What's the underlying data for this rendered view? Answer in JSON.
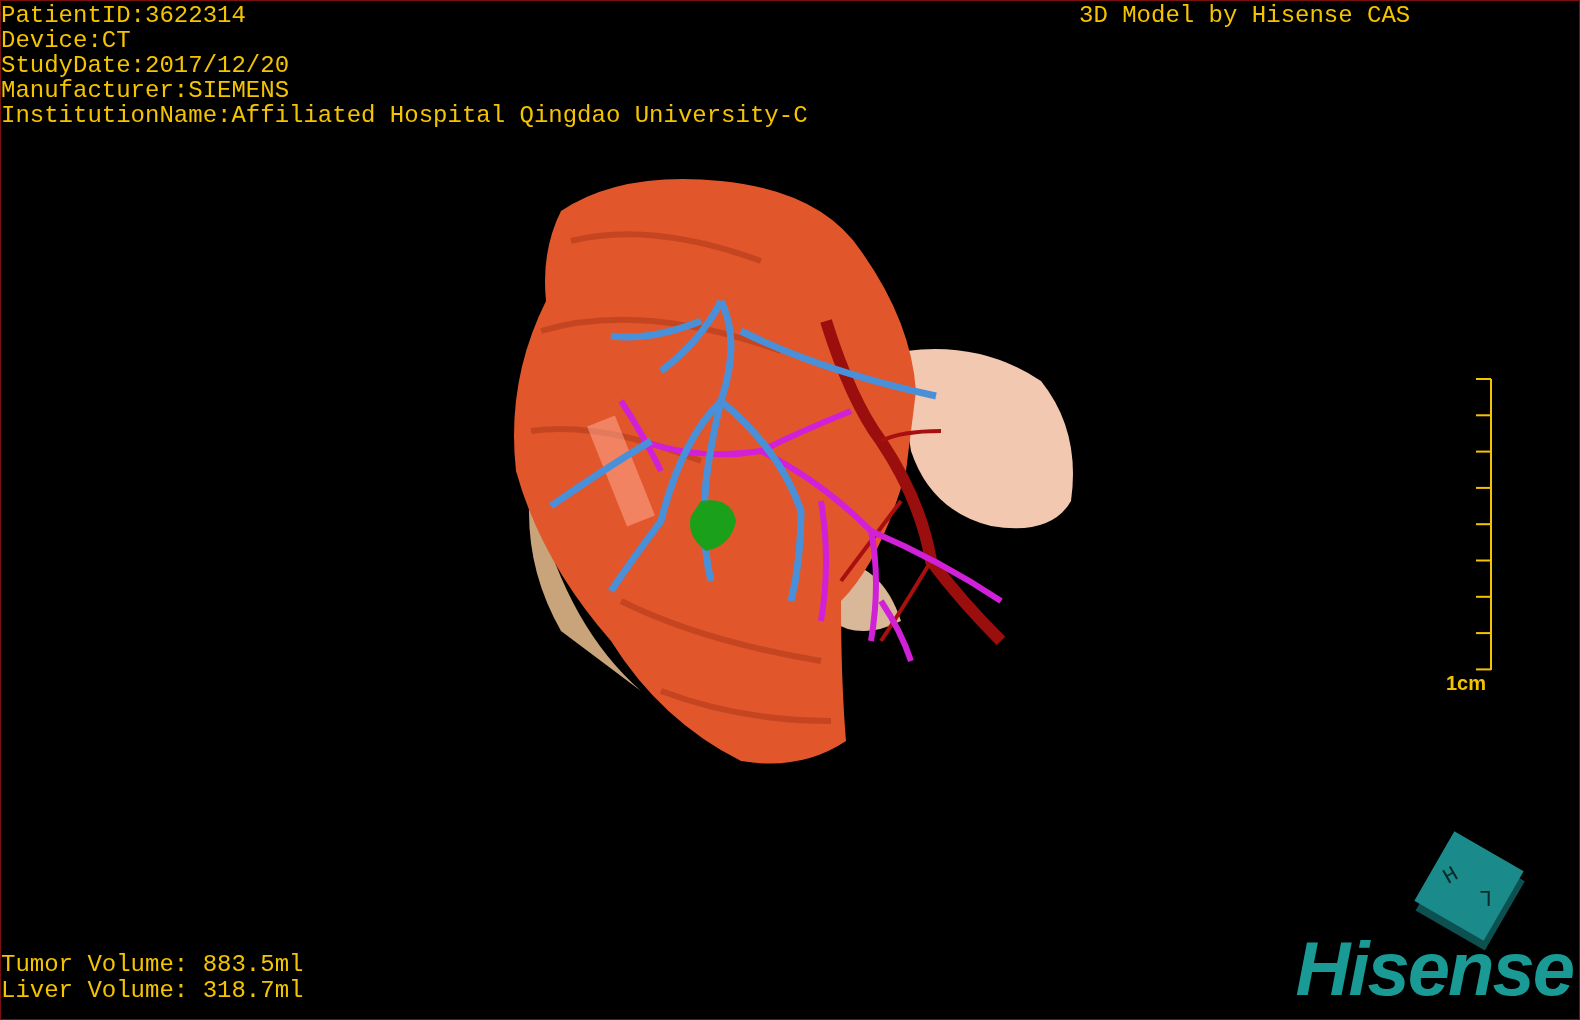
{
  "patient_info": [
    "PatientID:3622314",
    "Device:CT",
    "StudyDate:2017/12/20",
    "Manufacturer:SIEMENS",
    "InstitutionName:Affiliated Hospital Qingdao University-C"
  ],
  "model_credit": "3D Model by Hisense CAS",
  "scale_bar": {
    "label": "1cm"
  },
  "volumes": [
    "Tumor Volume: 883.5ml",
    "Liver Volume: 318.7ml"
  ],
  "orientation_cube": {
    "faces": [
      "H",
      "L"
    ]
  },
  "logo": "Hisense"
}
